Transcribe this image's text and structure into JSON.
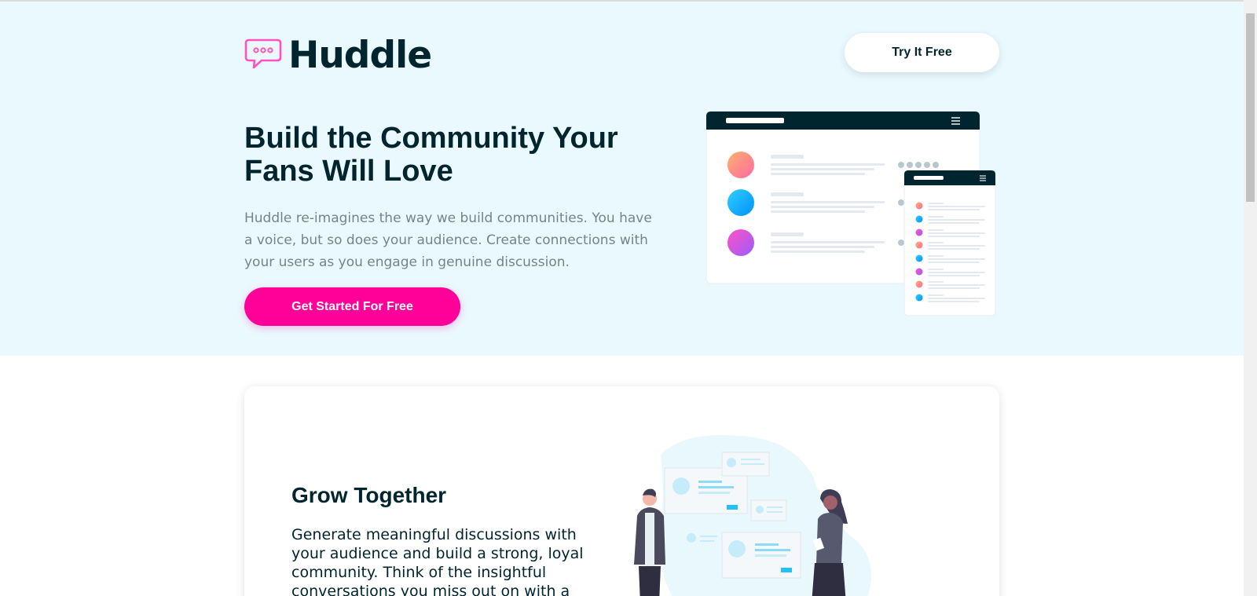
{
  "header": {
    "logo_text": "Huddle",
    "try_button_label": "Try It Free"
  },
  "hero": {
    "title": "Build the Community Your Fans Will Love",
    "description": "Huddle re-imagines the way we build communities. You have a voice, but so does your audience. Create connections with your users as you engage in genuine discussion.",
    "cta_label": "Get Started For Free"
  },
  "features": [
    {
      "title": "Grow Together",
      "text": "Generate meaningful discussions with your audience and build a strong, loyal community. Think of the insightful conversations you miss out on with a"
    }
  ],
  "colors": {
    "brand_dark": "#00252e",
    "brand_pink": "#ff0099",
    "hero_background": "#eaf9fe",
    "text_muted": "#758488"
  },
  "icons": {
    "logo": "speech-bubble-icon",
    "menu": "hamburger-menu-icon"
  }
}
